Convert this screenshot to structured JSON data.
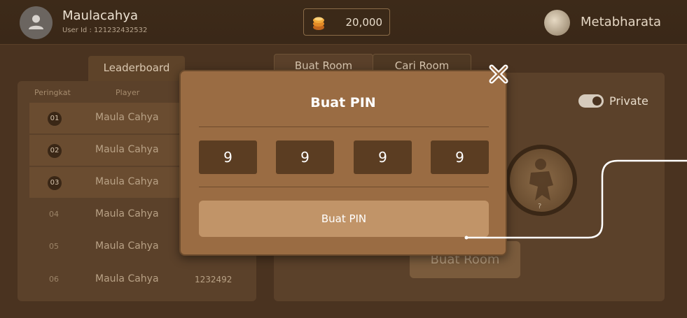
{
  "header": {
    "username": "Maulacahya",
    "user_id": "User Id : 121232432532",
    "coins": "20,000",
    "game_name": "Metabharata"
  },
  "leaderboard": {
    "tab_label": "Leaderboard",
    "col_rank": "Peringkat",
    "col_player": "Player",
    "rows": [
      {
        "rank": "01",
        "player": "Maula Cahya",
        "score": ""
      },
      {
        "rank": "02",
        "player": "Maula Cahya",
        "score": ""
      },
      {
        "rank": "03",
        "player": "Maula Cahya",
        "score": ""
      },
      {
        "rank": "04",
        "player": "Maula Cahya",
        "score": ""
      },
      {
        "rank": "05",
        "player": "Maula Cahya",
        "score": ""
      },
      {
        "rank": "06",
        "player": "Maula Cahya",
        "score": "1232492"
      }
    ]
  },
  "room": {
    "tab_create": "Buat Room",
    "tab_find": "Cari Room",
    "private_label": "Private",
    "private_enabled": true,
    "character_placeholder": "?",
    "create_button": "Buat Room"
  },
  "modal": {
    "title": "Buat PIN",
    "pin_digits": [
      "9",
      "9",
      "9",
      "9"
    ],
    "submit_label": "Buat PIN"
  },
  "colors": {
    "modal_bg": "#9a6c43",
    "pin_box": "#5b3d22",
    "submit_button": "#c19468"
  }
}
